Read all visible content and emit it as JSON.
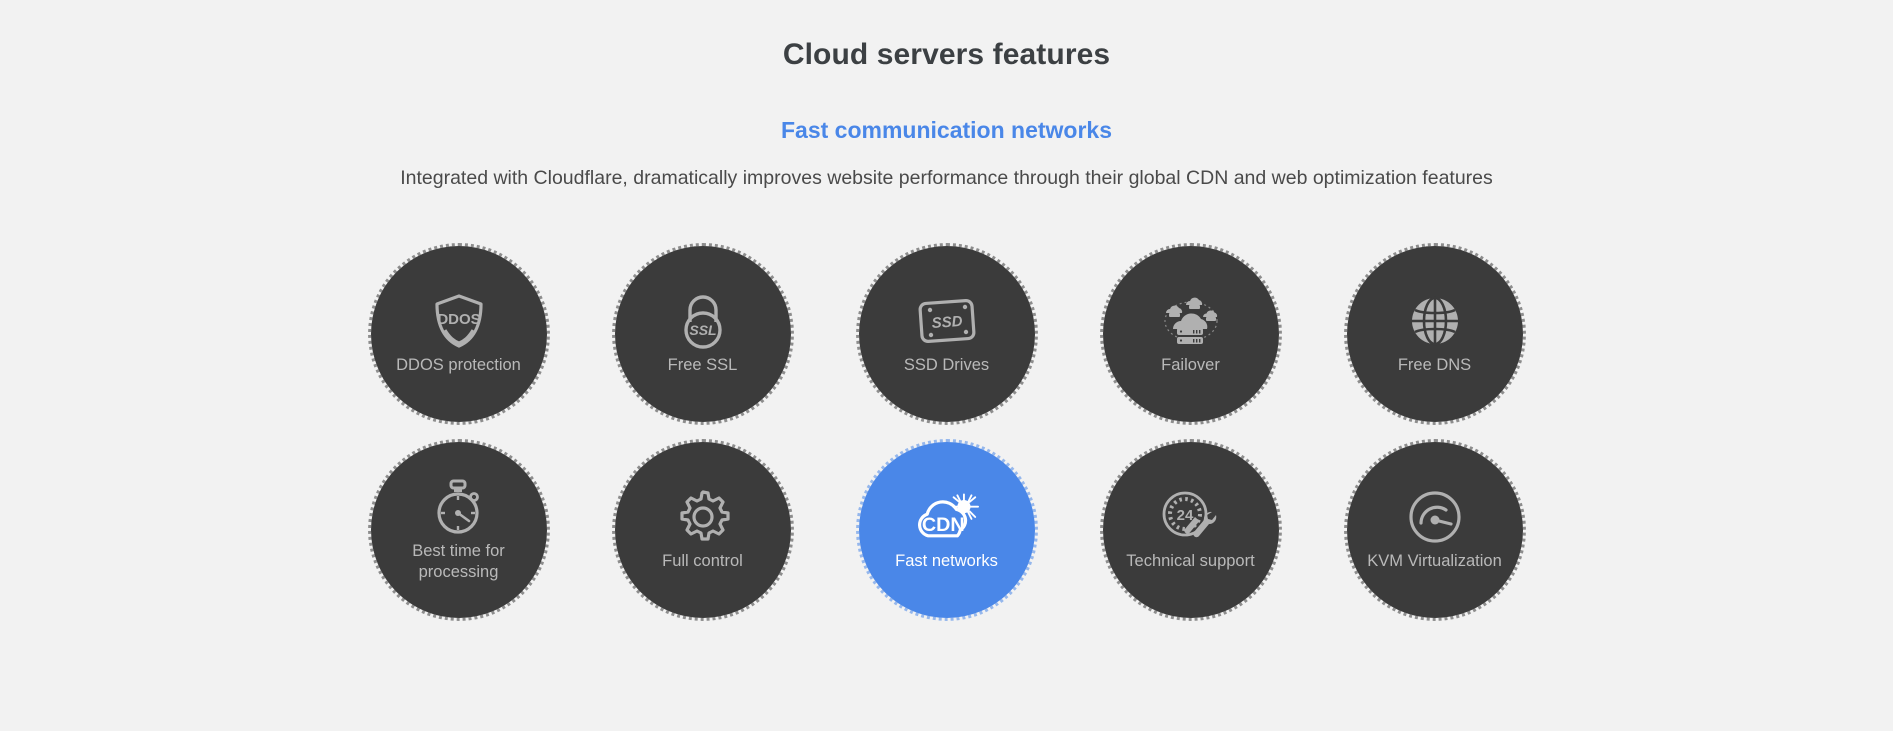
{
  "header": {
    "title": "Cloud servers features",
    "subtitle": "Fast communication networks",
    "description": "Integrated with Cloudflare, dramatically improves website performance through their global CDN and web optimization features"
  },
  "colors": {
    "background": "#f2f2f2",
    "circle": "#3b3b3b",
    "accent": "#4a87e8",
    "title": "#3c4043",
    "label": "#b9b9b9",
    "active_label": "#ffffff"
  },
  "features": {
    "row1": [
      {
        "label": "DDOS protection",
        "icon": "shield-ddos-icon",
        "icon_text": "DDOS",
        "active": false
      },
      {
        "label": "Free SSL",
        "icon": "padlock-ssl-icon",
        "icon_text": "SSL",
        "active": false
      },
      {
        "label": "SSD Drives",
        "icon": "ssd-drive-icon",
        "icon_text": "SSD",
        "active": false
      },
      {
        "label": "Failover",
        "icon": "cloud-servers-failover-icon",
        "icon_text": "",
        "active": false
      },
      {
        "label": "Free DNS",
        "icon": "globe-icon",
        "icon_text": "",
        "active": false
      }
    ],
    "row2": [
      {
        "label": "Best time for processing",
        "icon": "stopwatch-icon",
        "icon_text": "",
        "active": false
      },
      {
        "label": "Full control",
        "icon": "gear-icon",
        "icon_text": "",
        "active": false
      },
      {
        "label": "Fast networks",
        "icon": "cloud-cdn-icon",
        "icon_text": "CDN",
        "active": true
      },
      {
        "label": "Technical support",
        "icon": "support-24-tools-icon",
        "icon_text": "24",
        "active": false
      },
      {
        "label": "KVM Virtualization",
        "icon": "speedometer-icon",
        "icon_text": "",
        "active": false
      }
    ]
  }
}
